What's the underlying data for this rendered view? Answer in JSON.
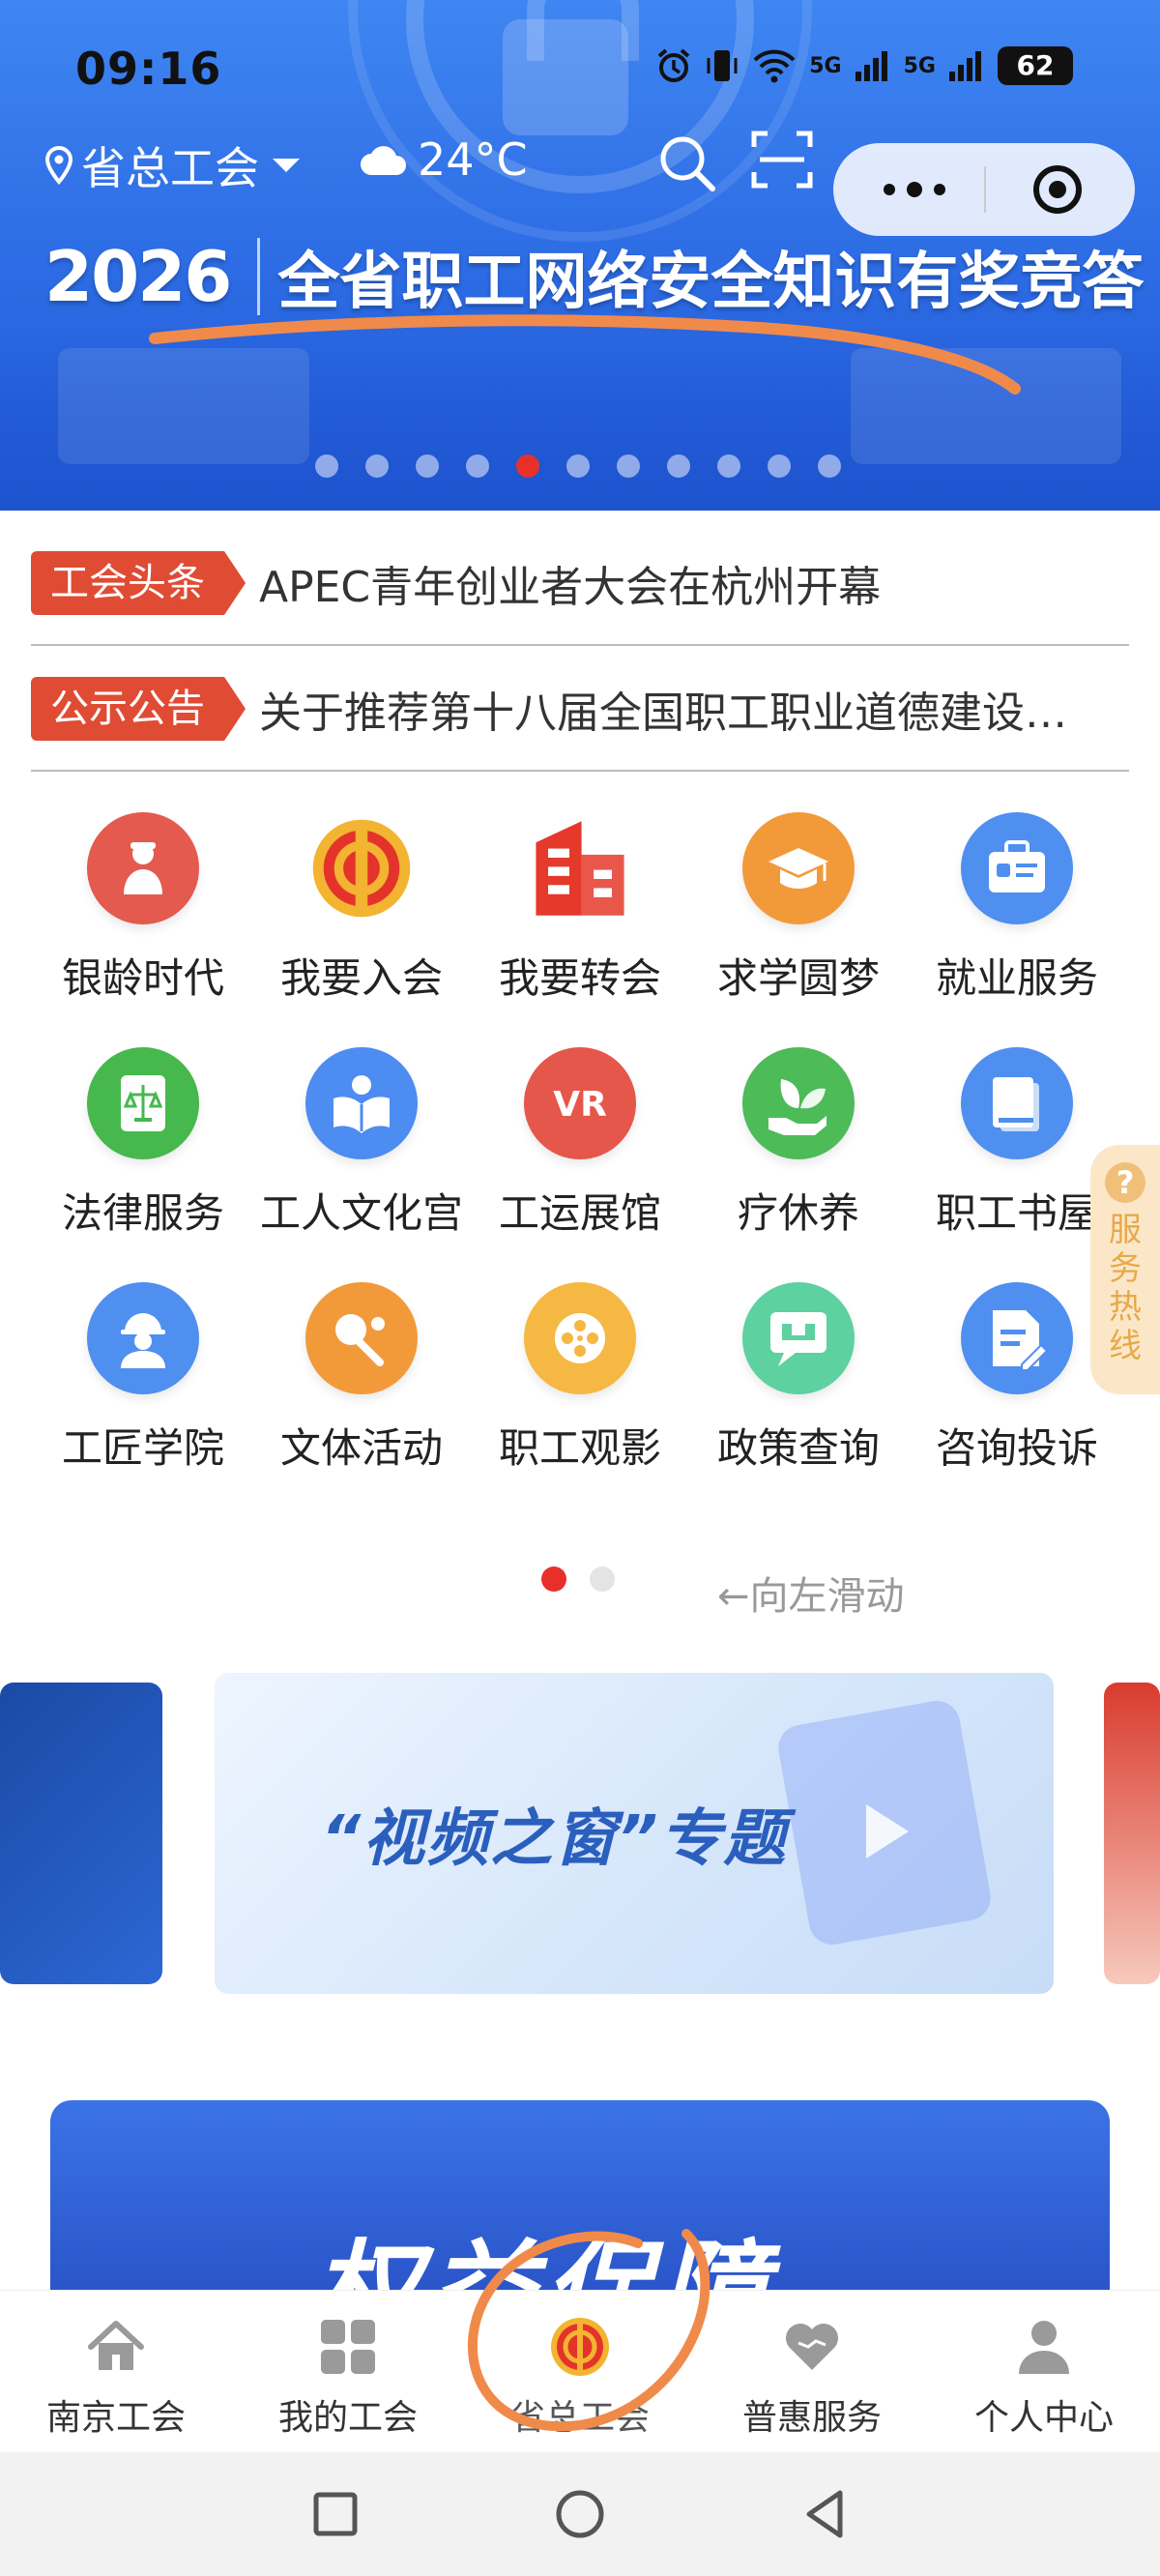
{
  "status_bar": {
    "time": "09:16",
    "network_1": "5G",
    "network_2": "5G",
    "battery": "62"
  },
  "header": {
    "location": "省总工会",
    "temperature": "24°C"
  },
  "banner": {
    "year": "2026",
    "title": "全省职工网络安全知识有奖竞答",
    "dot_count": 11,
    "active_dot": 4
  },
  "news": [
    {
      "tag": "工会头条",
      "text": "APEC青年创业者大会在杭州开幕"
    },
    {
      "tag": "公示公告",
      "text": "关于推荐第十八届全国职工职业道德建设…"
    }
  ],
  "services": [
    {
      "label": "银龄时代",
      "icon": "elder-person-icon",
      "color": "#e45a4f"
    },
    {
      "label": "我要入会",
      "icon": "union-emblem-icon",
      "color": "#e8302a"
    },
    {
      "label": "我要转会",
      "icon": "building-icon",
      "color": "#e5392c"
    },
    {
      "label": "求学圆梦",
      "icon": "graduation-cap-icon",
      "color": "#f29a3a"
    },
    {
      "label": "就业服务",
      "icon": "briefcase-icon",
      "color": "#4f8ff0"
    },
    {
      "label": "法律服务",
      "icon": "law-book-icon",
      "color": "#46b84e"
    },
    {
      "label": "工人文化宫",
      "icon": "reading-icon",
      "color": "#4d8cf0"
    },
    {
      "label": "工运展馆",
      "icon": "vr-icon",
      "color": "#e6574b"
    },
    {
      "label": "疗休养",
      "icon": "leaf-hand-icon",
      "color": "#4cbb58"
    },
    {
      "label": "职工书屋",
      "icon": "book-icon",
      "color": "#4f8ff0"
    },
    {
      "label": "工匠学院",
      "icon": "worker-icon",
      "color": "#4f8ff0"
    },
    {
      "label": "文体活动",
      "icon": "ping-pong-icon",
      "color": "#f29a3a"
    },
    {
      "label": "职工观影",
      "icon": "film-reel-icon",
      "color": "#f5b843"
    },
    {
      "label": "政策查询",
      "icon": "chat-icon",
      "color": "#5dd1a0"
    },
    {
      "label": "咨询投诉",
      "icon": "document-edit-icon",
      "color": "#4f8ff0"
    }
  ],
  "pager": {
    "swipe_hint": "←向左滑动"
  },
  "hotline": {
    "label": "服务热线"
  },
  "video_card": {
    "title": "“视频之窗”专题"
  },
  "big_banner": {
    "title": "权益保障"
  },
  "tabs": [
    {
      "label": "南京工会",
      "icon": "home-icon"
    },
    {
      "label": "我的工会",
      "icon": "grid-icon"
    },
    {
      "label": "省总工会",
      "icon": "union-emblem-icon"
    },
    {
      "label": "普惠服务",
      "icon": "heart-icon"
    },
    {
      "label": "个人中心",
      "icon": "person-icon"
    }
  ]
}
